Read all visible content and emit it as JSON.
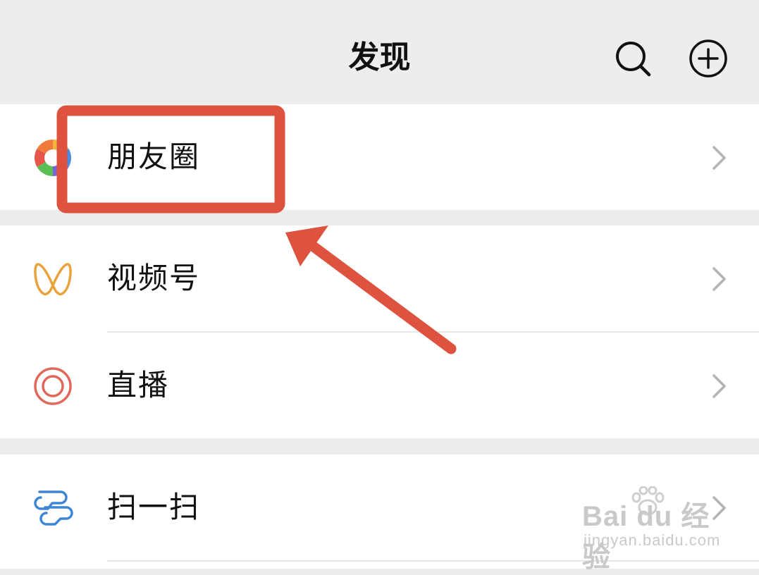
{
  "header": {
    "title": "发现",
    "search_icon": "search-icon",
    "add_icon": "plus-circle-icon"
  },
  "items": [
    {
      "label": "朋友圈",
      "icon": "moments-shutter-icon"
    },
    {
      "label": "视频号",
      "icon": "channels-icon"
    },
    {
      "label": "直播",
      "icon": "live-icon"
    },
    {
      "label": "扫一扫",
      "icon": "scan-icon"
    }
  ],
  "annotation": {
    "color": "#dd5340"
  },
  "watermark": {
    "brand": "Bai du 经验",
    "url": "jingyan.baidu.com"
  }
}
